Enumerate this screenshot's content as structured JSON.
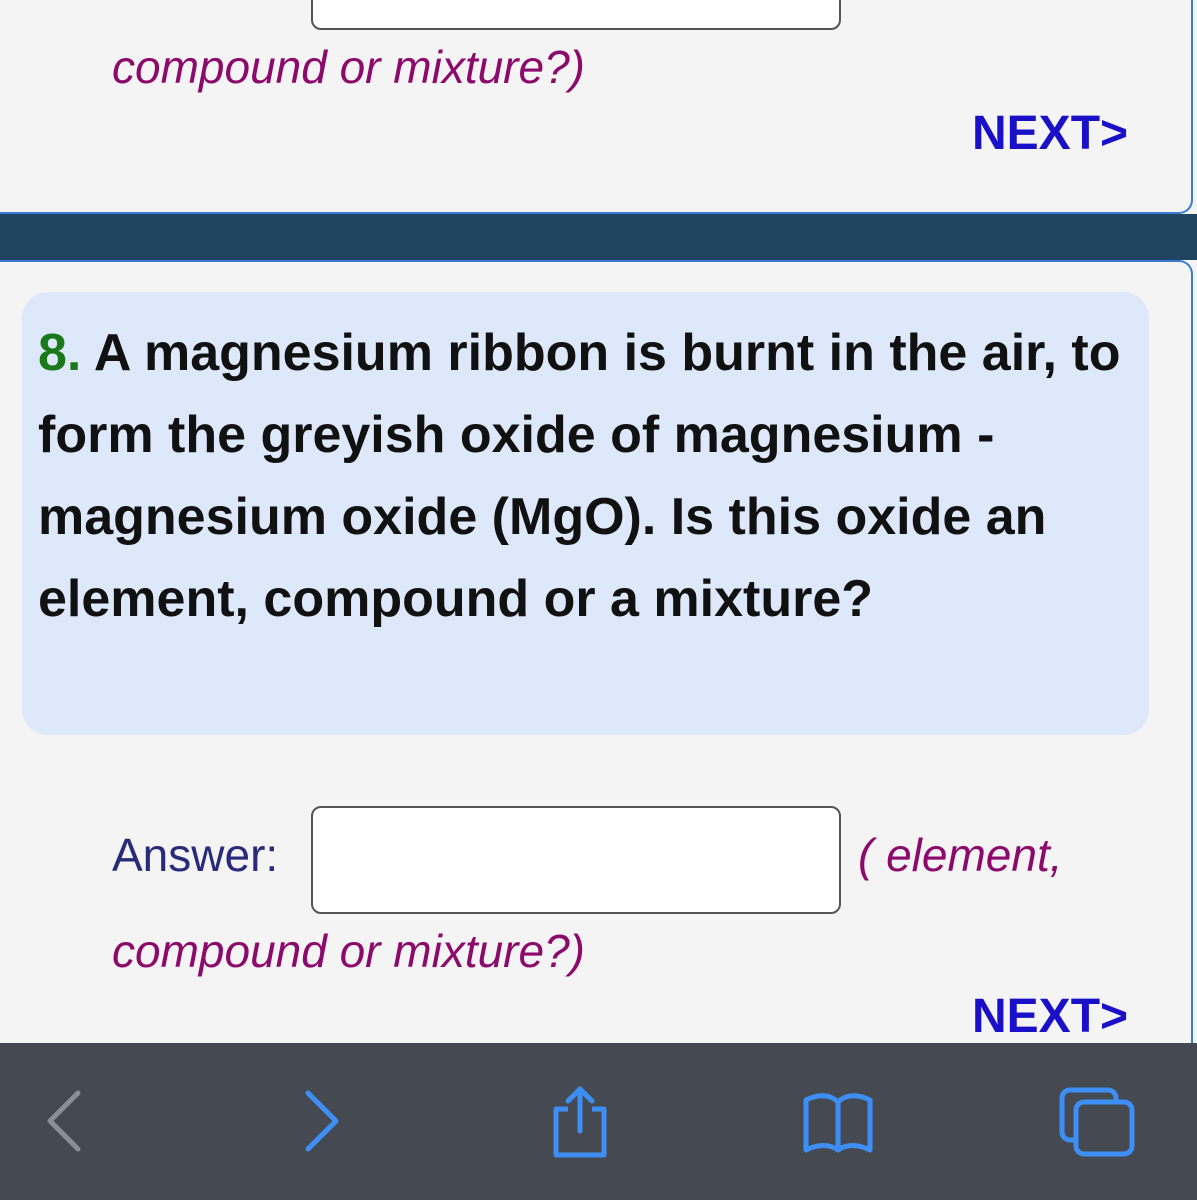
{
  "previous_question": {
    "hint": "compound or mixture?)",
    "next_label": "NEXT>"
  },
  "question": {
    "number": "8.",
    "text": " A magnesium ribbon is burnt in the air, to form the greyish oxide of magnesium - magnesium oxide (MgO). Is this oxide an element, compound or a mixture?",
    "answer_label": "Answer:",
    "answer_value": "",
    "hint_line1": "( element,",
    "hint_line2": "compound or mixture?)",
    "next_label": "NEXT>"
  },
  "browser_toolbar": {
    "icons": [
      "back-icon",
      "forward-icon",
      "share-icon",
      "bookmarks-icon",
      "tabs-icon"
    ],
    "colors": {
      "disabled": "#8a8f96",
      "active": "#3d8ff5"
    }
  }
}
